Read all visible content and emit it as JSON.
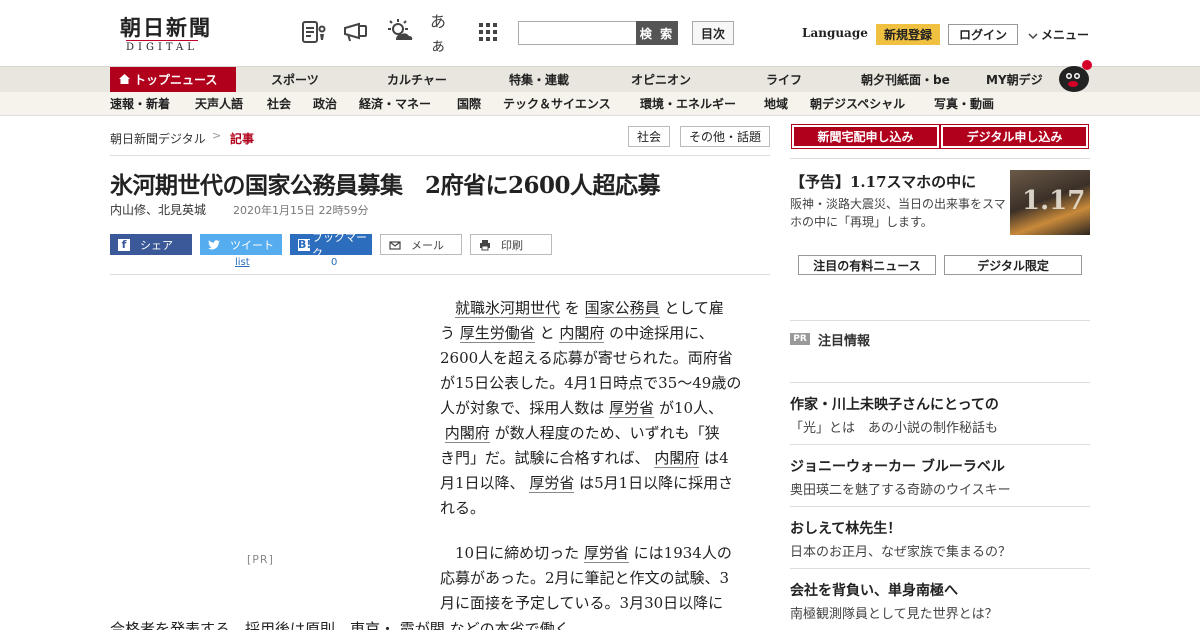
{
  "header": {
    "logo_jp": "朝日新聞",
    "logo_en": "DIGITAL",
    "icons": [
      "paper-news-icon",
      "megaphone-icon",
      "weather-icon",
      "font-size-icon",
      "grid-apps-icon"
    ],
    "font_icon_text": "あぁ",
    "search_placeholder": "",
    "search_label": "検 索",
    "toc_label": "目次",
    "language_label": "Language",
    "register_label": "新規登録",
    "login_label": "ログイン",
    "menu_label": "メニュー"
  },
  "main_nav": [
    "トップニュース",
    "スポーツ",
    "カルチャー",
    "特集・連載",
    "オピニオン",
    "ライフ",
    "朝夕刊紙面・be",
    "MY朝デジ"
  ],
  "sub_nav": [
    "速報・新着",
    "天声人語",
    "社会",
    "政治",
    "経済・マネー",
    "国際",
    "テック＆サイエンス",
    "環境・エネルギー",
    "地域",
    "朝デジスペシャル",
    "写真・動画"
  ],
  "breadcrumb": {
    "home": "朝日新聞デジタル",
    "sep": ">",
    "current": "記事"
  },
  "tags": [
    "社会",
    "その他・話題"
  ],
  "article": {
    "headline": "氷河期世代の国家公務員募集　2府省に2600人超応募",
    "byline": "内山修、北見英城",
    "date": "2020年1月15日 22時59分",
    "share": {
      "facebook": "シェア",
      "twitter": "ツイート",
      "hatena": "ブックマーク",
      "mail": "メール",
      "print": "印刷",
      "twitter_count": "list",
      "hatena_count": "0"
    },
    "pr_label": "[PR]",
    "p1": {
      "l1a": "就職氷河期世代",
      "l1b": " を ",
      "l1c": "国家公務員",
      "l1d": " として雇",
      "l2a": "う ",
      "l2b": "厚生労働省",
      "l2c": " と ",
      "l2d": "内閣府",
      "l2e": " の中途採用に、",
      "l3": "2600人を超える応募が寄せられた。両府省",
      "l4": "が15日公表した。4月1日時点で35～49歳の",
      "l5a": "人が対象で、採用人数は ",
      "l5b": "厚労省",
      "l5c": " が10人、",
      "l6a": "内閣府",
      "l6b": " が数人程度のため、いずれも「狭",
      "l7a": "き門」だ。試験に合格すれば、 ",
      "l7b": "内閣府",
      "l7c": " は4",
      "l8a": "月1日以降、 ",
      "l8b": "厚労省",
      "l8c": " は5月1日以降に採用さ",
      "l9": "れる。"
    },
    "p2": {
      "l1a": "10日に締め切った ",
      "l1b": "厚労省",
      "l1c": " には1934人の",
      "l2": "応募があった。2月に筆記と作文の試験、3",
      "l3": "月に面接を予定している。3月30日以降に",
      "l4a": "合格者を発表する。採用後は原則、東京・ ",
      "l4b": "霞が関",
      "l4c": " などの本省で働く"
    }
  },
  "sidebar": {
    "subscribe_paper": "新聞宅配申し込み",
    "subscribe_digital": "デジタル申し込み",
    "promo": {
      "title": "【予告】1.17スマホの中に",
      "text": "阪神・淡路大震災、当日の出来事をスマホの中に「再現」します。",
      "image_text": "1.17"
    },
    "btn_paid_news": "注目の有料ニュース",
    "btn_digital_only": "デジタル限定",
    "pr_badge": "PR",
    "pr_heading": "注目情報",
    "ads": [
      {
        "title": "作家・川上未映子さんにとっての",
        "sub": "「光」とは　あの小説の制作秘話も"
      },
      {
        "title": "ジョニーウォーカー ブルーラベル",
        "sub": "奥田瑛二を魅了する奇跡のウイスキー"
      },
      {
        "title": "おしえて林先生！",
        "sub": "日本のお正月、なぜ家族で集まるの？"
      },
      {
        "title": "会社を背負い、単身南極へ",
        "sub": "南極観測隊員として見た世界とは？"
      }
    ]
  },
  "colors": {
    "brand_red": "#b1001c",
    "register_yellow": "#f0c040",
    "facebook": "#3b5998",
    "twitter": "#55acee",
    "hatena": "#2c6ebd"
  }
}
